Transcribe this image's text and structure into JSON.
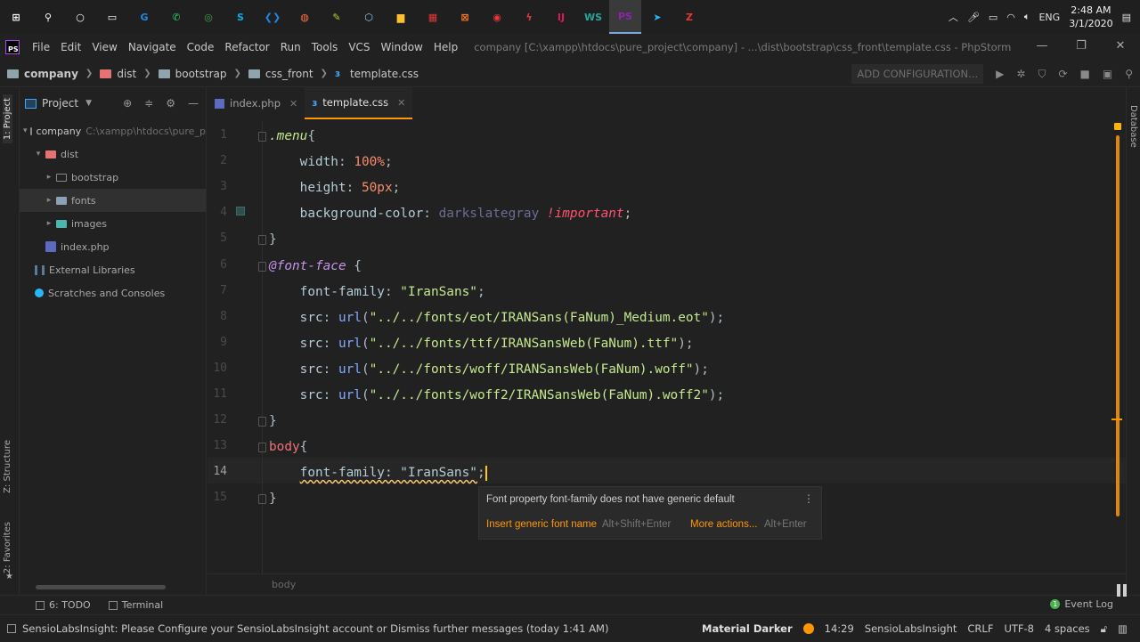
{
  "taskbar": {
    "apps": [
      {
        "icon": "windows-start-icon",
        "glyph": "⊞",
        "color": "#ffffff"
      },
      {
        "icon": "search-icon",
        "glyph": "⚲",
        "color": "#ffffff"
      },
      {
        "icon": "cortana-icon",
        "glyph": "○",
        "color": "#ffffff"
      },
      {
        "icon": "task-view-icon",
        "glyph": "▭",
        "color": "#ffffff"
      },
      {
        "icon": "app-icon",
        "glyph": "G",
        "color": "#1e88e5"
      },
      {
        "icon": "whatsapp-icon",
        "glyph": "✆",
        "color": "#25d366"
      },
      {
        "icon": "app-green-icon",
        "glyph": "◎",
        "color": "#43a047"
      },
      {
        "icon": "skype-icon",
        "glyph": "S",
        "color": "#00aff0"
      },
      {
        "icon": "vscode-icon",
        "glyph": "❮❯",
        "color": "#1e88e5"
      },
      {
        "icon": "app-orange-icon",
        "glyph": "◍",
        "color": "#ff7043"
      },
      {
        "icon": "notes-icon",
        "glyph": "✎",
        "color": "#c0ca33"
      },
      {
        "icon": "virtualbox-icon",
        "glyph": "⬡",
        "color": "#90caf9"
      },
      {
        "icon": "file-explorer-icon",
        "glyph": "▆",
        "color": "#fbc02d"
      },
      {
        "icon": "app-tiles-icon",
        "glyph": "▦",
        "color": "#e53935"
      },
      {
        "icon": "xampp-icon",
        "glyph": "⊠",
        "color": "#fb7a24"
      },
      {
        "icon": "chrome-icon",
        "glyph": "◉",
        "color": "#e53935"
      },
      {
        "icon": "app-red-icon",
        "glyph": "ϟ",
        "color": "#e53935"
      },
      {
        "icon": "intellij-icon",
        "glyph": "IJ",
        "color": "#d81b60"
      },
      {
        "icon": "webstorm-icon",
        "glyph": "WS",
        "color": "#26a69a"
      },
      {
        "icon": "phpstorm-icon",
        "glyph": "PS",
        "color": "#8e24aa",
        "active": true
      },
      {
        "icon": "telegram-icon",
        "glyph": "➤",
        "color": "#29b6f6"
      },
      {
        "icon": "app-filezilla-icon",
        "glyph": "Z",
        "color": "#e53935"
      }
    ],
    "tray": {
      "language": "ENG",
      "time": "2:48 AM",
      "date": "3/1/2020"
    }
  },
  "menubar": {
    "items": [
      "File",
      "Edit",
      "View",
      "Navigate",
      "Code",
      "Refactor",
      "Run",
      "Tools",
      "VCS",
      "Window",
      "Help"
    ],
    "window_title": "company [C:\\xampp\\htdocs\\pure_project\\company] - ...\\dist\\bootstrap\\css_front\\template.css - PhpStorm"
  },
  "navbar": {
    "breadcrumbs": [
      "company",
      "dist",
      "bootstrap",
      "css_front",
      "template.css"
    ],
    "add_configuration": "ADD CONFIGURATION..."
  },
  "tool_stripe": {
    "project": "1: Project",
    "structure": "Z: Structure",
    "favorites": "2: Favorites"
  },
  "project_panel": {
    "title": "Project",
    "tree": [
      {
        "label": "company",
        "path": "C:\\xampp\\htdocs\\pure_proje",
        "indent": 0,
        "kind": "project"
      },
      {
        "label": "dist",
        "indent": 1,
        "kind": "folder-red",
        "open": true
      },
      {
        "label": "bootstrap",
        "indent": 2,
        "kind": "folder"
      },
      {
        "label": "fonts",
        "indent": 2,
        "kind": "folder-fonts",
        "selected": true
      },
      {
        "label": "images",
        "indent": 2,
        "kind": "folder-images"
      },
      {
        "label": "index.php",
        "indent": 1,
        "kind": "php"
      },
      {
        "label": "External Libraries",
        "indent": 0,
        "kind": "lib"
      },
      {
        "label": "Scratches and Consoles",
        "indent": 0,
        "kind": "scratch"
      }
    ]
  },
  "tabs": [
    {
      "label": "index.php",
      "kind": "php"
    },
    {
      "label": "template.css",
      "kind": "css",
      "active": true
    }
  ],
  "editor": {
    "line_numbers": [
      "1",
      "2",
      "3",
      "4",
      "5",
      "6",
      "7",
      "8",
      "9",
      "10",
      "11",
      "12",
      "13",
      "14",
      "15"
    ],
    "current_line": 14,
    "breadcrumb": "body",
    "lines": [
      [
        [
          ".menu",
          "sel"
        ],
        [
          "{",
          ""
        ]
      ],
      [
        [
          "    width",
          "prop"
        ],
        [
          ": ",
          ""
        ],
        [
          "100%",
          "num"
        ],
        [
          ";",
          ""
        ]
      ],
      [
        [
          "    height",
          "prop"
        ],
        [
          ": ",
          ""
        ],
        [
          "50px",
          "num"
        ],
        [
          ";",
          ""
        ]
      ],
      [
        [
          "    background-color",
          "prop"
        ],
        [
          ": ",
          ""
        ],
        [
          "darkslategray",
          "val"
        ],
        [
          " ",
          ""
        ],
        [
          "!important",
          "kw"
        ],
        [
          ";",
          ""
        ]
      ],
      [
        [
          "}",
          ""
        ]
      ],
      [
        [
          "@font-face",
          "at"
        ],
        [
          " {",
          ""
        ]
      ],
      [
        [
          "    font-family",
          "prop"
        ],
        [
          ": ",
          ""
        ],
        [
          "\"IranSans\"",
          "str"
        ],
        [
          ";",
          ""
        ]
      ],
      [
        [
          "    src",
          "prop"
        ],
        [
          ": ",
          ""
        ],
        [
          "url",
          "fn"
        ],
        [
          "(",
          ""
        ],
        [
          "\"../../fonts/eot/IRANSans(FaNum)_Medium.eot\"",
          "str"
        ],
        [
          ");",
          ""
        ]
      ],
      [
        [
          "    src",
          "prop"
        ],
        [
          ": ",
          ""
        ],
        [
          "url",
          "fn"
        ],
        [
          "(",
          ""
        ],
        [
          "\"../../fonts/ttf/IRANSansWeb(FaNum).ttf\"",
          "str"
        ],
        [
          ");",
          ""
        ]
      ],
      [
        [
          "    src",
          "prop"
        ],
        [
          ": ",
          ""
        ],
        [
          "url",
          "fn"
        ],
        [
          "(",
          ""
        ],
        [
          "\"../../fonts/woff/IRANSansWeb(FaNum).woff\"",
          "str"
        ],
        [
          ");",
          ""
        ]
      ],
      [
        [
          "    src",
          "prop"
        ],
        [
          ": ",
          ""
        ],
        [
          "url",
          "fn"
        ],
        [
          "(",
          ""
        ],
        [
          "\"../../fonts/woff2/IRANSansWeb(FaNum).woff2\"",
          "str"
        ],
        [
          ");",
          ""
        ]
      ],
      [
        [
          "}",
          ""
        ]
      ],
      [
        [
          "body",
          "tag"
        ],
        [
          "{",
          ""
        ]
      ],
      [
        [
          "    ",
          ""
        ],
        [
          "font-family: \"IranSans\"",
          "warn"
        ],
        [
          ";",
          ""
        ]
      ],
      [
        [
          "}",
          ""
        ]
      ]
    ]
  },
  "inspection": {
    "message": "Font property font-family does not have generic default",
    "action1": "Insert generic font name",
    "shortcut1": "Alt+Shift+Enter",
    "action2": "More actions...",
    "shortcut2": "Alt+Enter"
  },
  "right_stripe": {
    "database": "Database"
  },
  "bottom_tools": {
    "todo": "6: TODO",
    "terminal": "Terminal",
    "event_log": "Event Log"
  },
  "statusbar": {
    "message": "SensioLabsInsight: Please Configure your SensioLabsInsight account or Dismiss further messages (today 1:41 AM)",
    "theme": "Material Darker",
    "position": "14:29",
    "plugin": "SensioLabsInsight",
    "line_sep": "CRLF",
    "encoding": "UTF-8",
    "indent": "4 spaces"
  }
}
